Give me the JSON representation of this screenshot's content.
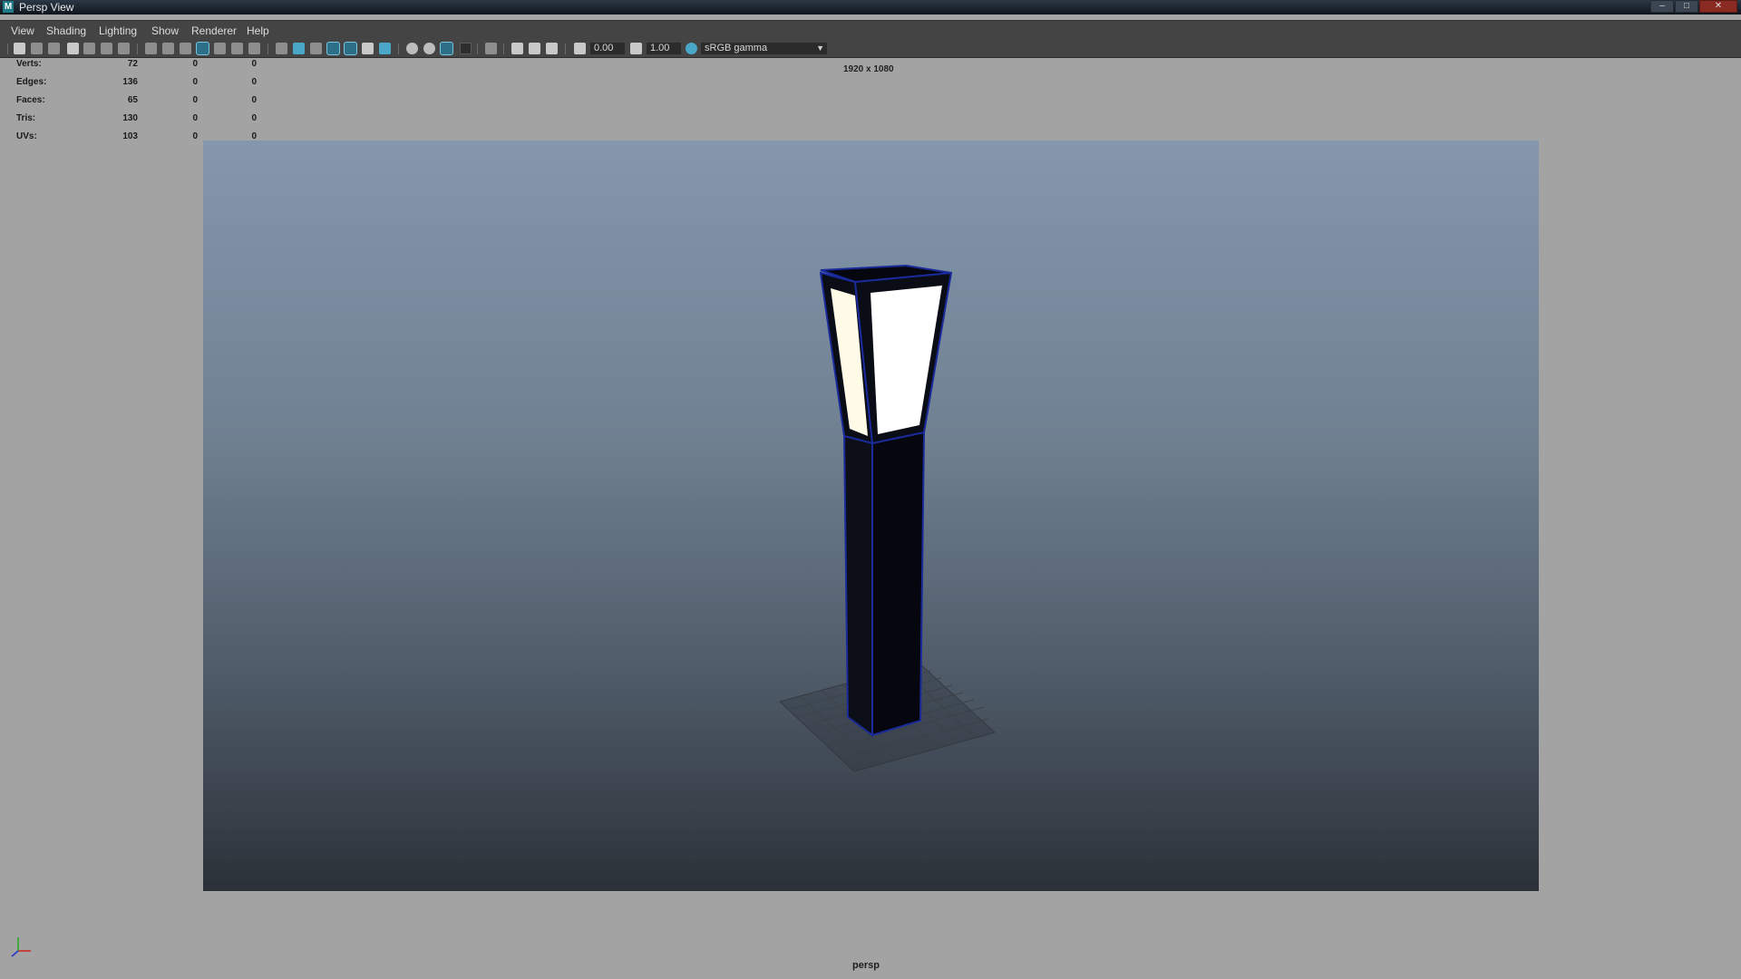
{
  "window": {
    "title": "Persp View",
    "app_icon": "M",
    "minimize": "–",
    "maximize": "□",
    "close": "✕"
  },
  "menu": [
    "View",
    "Shading",
    "Lighting",
    "Show",
    "Renderer",
    "Help"
  ],
  "toolbar": {
    "exposure": "0.00",
    "gamma": "1.00",
    "color_space": "sRGB gamma",
    "color_space_arrow": "▼"
  },
  "hud": {
    "rows": [
      {
        "label": "Verts:",
        "v1": "72",
        "v2": "0",
        "v3": "0"
      },
      {
        "label": "Edges:",
        "v1": "136",
        "v2": "0",
        "v3": "0"
      },
      {
        "label": "Faces:",
        "v1": "65",
        "v2": "0",
        "v3": "0"
      },
      {
        "label": "Tris:",
        "v1": "130",
        "v2": "0",
        "v3": "0"
      },
      {
        "label": "UVs:",
        "v1": "103",
        "v2": "0",
        "v3": "0"
      }
    ]
  },
  "viewport": {
    "resolution": "1920 x 1080",
    "camera": "persp"
  },
  "colors": {
    "viewport_bg": "#a3a3a3",
    "lamp_body": "#070914",
    "lamp_edge": "#1a2a9a",
    "lamp_glass": "#fffbe6"
  }
}
